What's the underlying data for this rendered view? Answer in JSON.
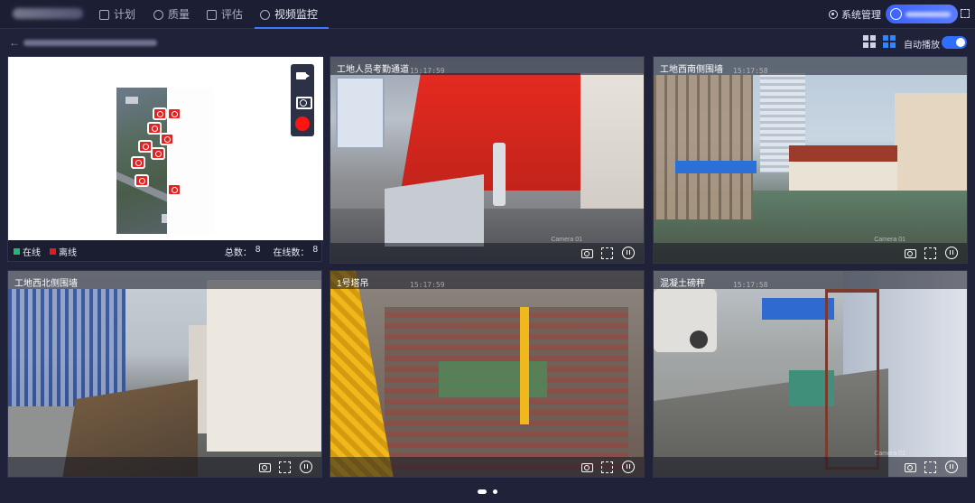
{
  "nav": {
    "items": [
      {
        "label": "计划",
        "icon": "plan-icon"
      },
      {
        "label": "质量",
        "icon": "quality-icon"
      },
      {
        "label": "评估",
        "icon": "evaluate-icon"
      },
      {
        "label": "视频监控",
        "icon": "video-icon",
        "active": true
      }
    ],
    "system_label": "系统管理"
  },
  "toolbar": {
    "auto_play_label": "自动播放",
    "auto_play_on": true
  },
  "map_panel": {
    "legend_online": "在线",
    "legend_offline": "离线",
    "online_color": "#21b86f",
    "offline_color": "#e51a1a",
    "total_label": "总数：",
    "total_value": "8",
    "online_label": "在线数：",
    "online_value": "8"
  },
  "cameras": [
    {
      "title": "工地人员考勤通道",
      "timestamp": "15:17:59",
      "camera_label": "Camera 01"
    },
    {
      "title": "工地西南侧围墙",
      "timestamp": "15:17:58",
      "camera_label": "Camera 01"
    },
    {
      "title": "工地西北侧围墙",
      "timestamp": "",
      "camera_label": ""
    },
    {
      "title": "1号塔吊",
      "timestamp": "15:17:59",
      "camera_label": ""
    },
    {
      "title": "混凝土磅秤",
      "timestamp": "15:17:58",
      "camera_label": "Camera 01"
    }
  ],
  "pager": {
    "pages": 2,
    "current": 1
  }
}
